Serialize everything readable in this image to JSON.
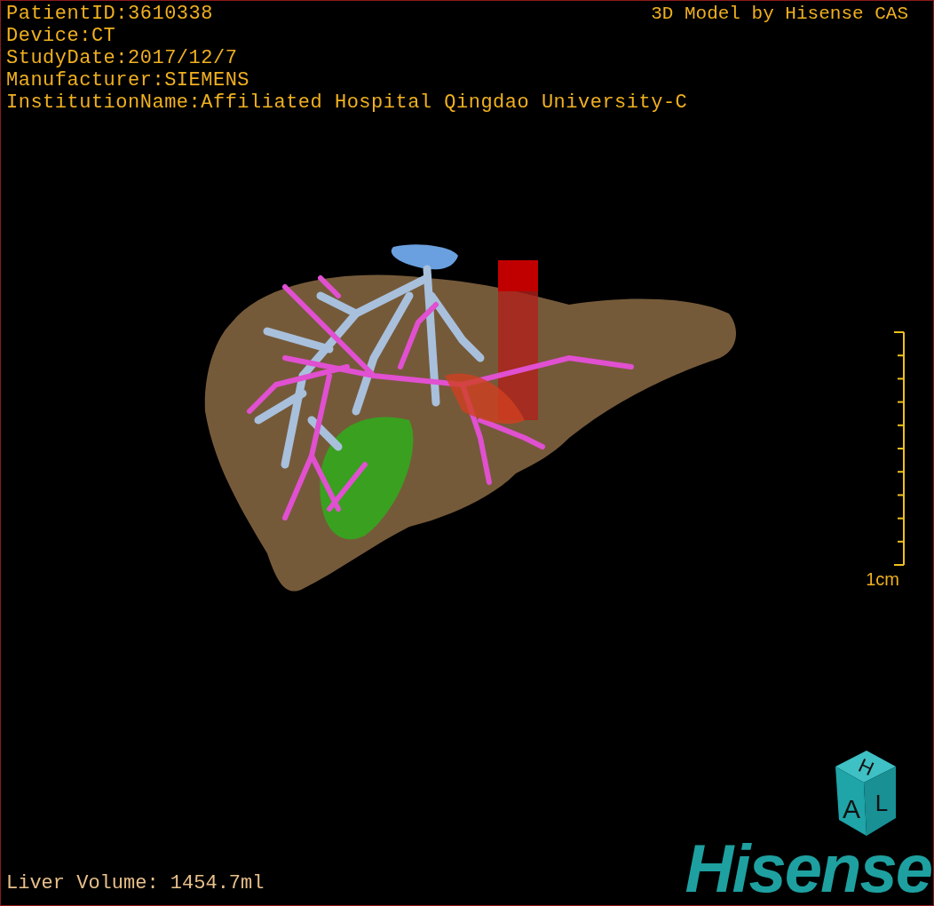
{
  "info_lines": [
    "PatientID:3610338",
    "Device:CT",
    "StudyDate:2017/12/7",
    "Manufacturer:SIEMENS",
    "InstitutionName:Affiliated Hospital Qingdao University-C"
  ],
  "model_credit": "3D Model by Hisense CAS",
  "scale": {
    "label": "1cm"
  },
  "orientation_cube": {
    "labels": [
      "H",
      "A",
      "L"
    ]
  },
  "logo": "Hisense",
  "liver_volume": "Liver Volume: 1454.7ml"
}
